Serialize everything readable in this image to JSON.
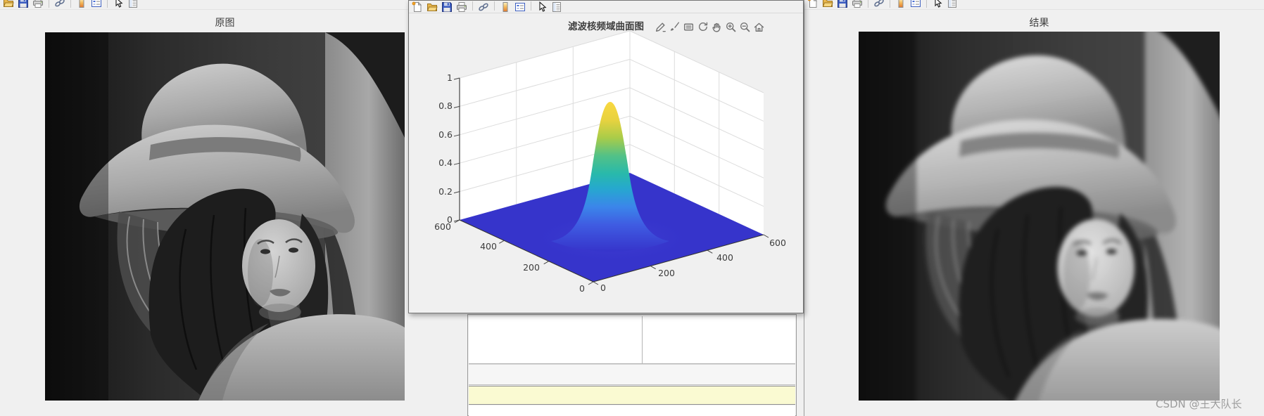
{
  "windows": {
    "left": {
      "title": "原图",
      "toolbar": [
        "open-file",
        "save-figure",
        "print-figure",
        "|",
        "link-plot",
        "|",
        "insert-colorbar",
        "insert-legend",
        "|",
        "edit-plot",
        "property-inspector"
      ]
    },
    "center": {
      "title": "滤波核频域曲面图",
      "toolbar": [
        "new-figure",
        "open-file",
        "save-figure",
        "print-figure",
        "|",
        "link-plot",
        "|",
        "insert-colorbar",
        "insert-legend",
        "|",
        "edit-plot",
        "property-inspector"
      ],
      "axes_toolbar": [
        "export",
        "brush",
        "datatips",
        "rotate-3d",
        "pan",
        "zoom-in",
        "zoom-out",
        "restore-view"
      ],
      "z_ticks": [
        "1",
        "0.8",
        "0.6",
        "0.4",
        "0.2",
        "0"
      ],
      "y_ticks": [
        "600",
        "400",
        "200",
        "0"
      ],
      "x_ticks": [
        "0",
        "200",
        "400",
        "600"
      ]
    },
    "right": {
      "title": "结果",
      "toolbar": [
        "new-figure",
        "open-file",
        "save-figure",
        "print-figure",
        "|",
        "link-plot",
        "|",
        "insert-colorbar",
        "insert-legend",
        "|",
        "edit-plot",
        "property-inspector"
      ]
    }
  },
  "watermark": "CSDN @王大队长",
  "colors": {
    "window_bg": "#f0f0f0",
    "surface_floor": "#3634cb",
    "peak_top": "#f9d840",
    "highlight_strip": "#fafad2",
    "axis_text": "#3c3c3c"
  },
  "chart_data": {
    "type": "area",
    "subtype": "3d-surface",
    "title": "滤波核频域曲面图",
    "x_ticks": [
      0,
      200,
      400,
      600
    ],
    "y_ticks": [
      0,
      200,
      400,
      600
    ],
    "z_ticks": [
      0,
      0.2,
      0.4,
      0.6,
      0.8,
      1
    ],
    "xlim": [
      0,
      600
    ],
    "ylim": [
      0,
      600
    ],
    "zlim": [
      0,
      1
    ],
    "grid": true,
    "colormap": "parula",
    "description": "Frequency-domain surface of a Gaussian low-pass filter kernel: value near 0 (flat dark-blue plane) over the whole 0-600 x 0-600 domain with a single narrow Gaussian peak at the center",
    "peak": {
      "x": 300,
      "y": 300,
      "z": 0.88
    },
    "base_value": 0
  }
}
